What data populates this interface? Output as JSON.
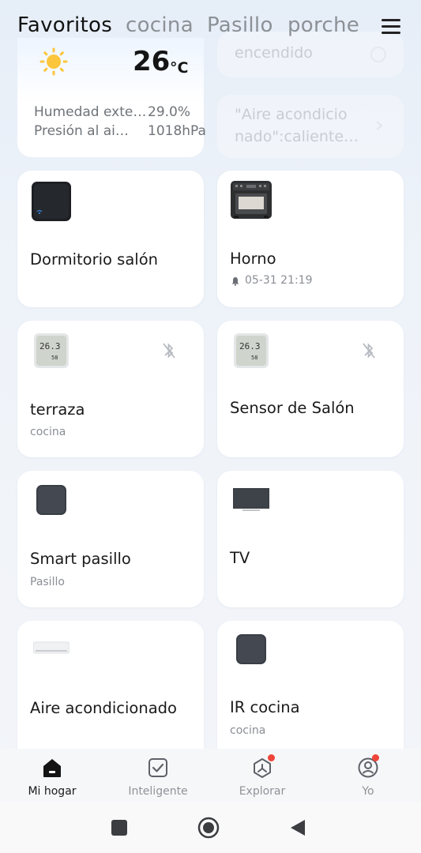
{
  "tabs": [
    "Favoritos",
    "cocina",
    "Pasillo",
    "porche"
  ],
  "weather": {
    "temperature": "26",
    "unit": "°C",
    "humidity_label": "Humedad exte…",
    "humidity_value": "29.0%",
    "pressure_label": "Presión al ai…",
    "pressure_value": "1018hPa"
  },
  "faded_cards": {
    "top": "encendido",
    "bottom_line1": "\"Aire acondicio",
    "bottom_line2": "nado\":caliente…"
  },
  "devices": [
    {
      "name": "Dormitorio salón",
      "sub": ""
    },
    {
      "name": "Horno",
      "sub": "05-31 21:19"
    },
    {
      "name": "terraza",
      "sub": "cocina"
    },
    {
      "name": "Sensor de Salón",
      "sub": ""
    },
    {
      "name": "Smart pasillo",
      "sub": "Pasillo"
    },
    {
      "name": "TV",
      "sub": ""
    },
    {
      "name": "Aire acondicionado",
      "sub": ""
    },
    {
      "name": "IR cocina",
      "sub": "cocina"
    }
  ],
  "sensor_display": {
    "temp": "26.3",
    "hum": "58"
  },
  "bottom_nav": [
    {
      "label": "Mi hogar",
      "icon": "home-icon",
      "active": true
    },
    {
      "label": "Inteligente",
      "icon": "checkbox-icon"
    },
    {
      "label": "Explorar",
      "icon": "compass-icon",
      "badge": true
    },
    {
      "label": "Yo",
      "icon": "profile-icon",
      "badge": true
    }
  ],
  "colors": {
    "accent": "#1a1a1a",
    "badge": "#f0453a",
    "card": "#ffffff"
  }
}
